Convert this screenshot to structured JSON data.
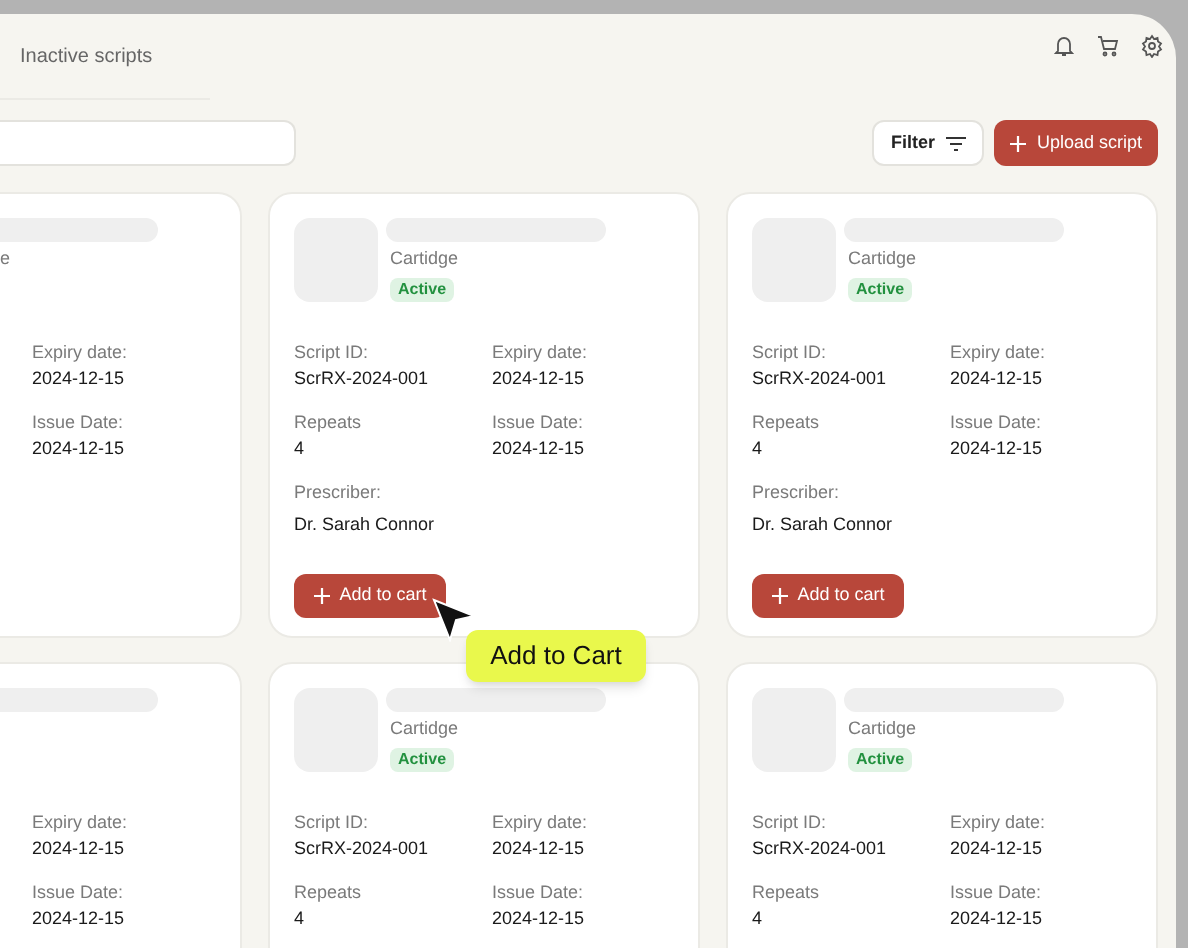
{
  "header": {
    "tab": "Inactive scripts"
  },
  "toolbar": {
    "filter": "Filter",
    "upload": "Upload script"
  },
  "cards": [
    {
      "kind": "clipped",
      "type": "e",
      "fields": [
        {
          "label": "Expiry date:",
          "value": "2024-12-15"
        },
        {
          "label": "Issue Date:",
          "value": "2024-12-15"
        }
      ]
    },
    {
      "kind": "full",
      "type": "Cartidge",
      "status": "Active",
      "fields": [
        {
          "label": "Script ID:",
          "value": "ScrRX-2024-001"
        },
        {
          "label": "Expiry date:",
          "value": "2024-12-15"
        },
        {
          "label": "Repeats",
          "value": "4"
        },
        {
          "label": "Issue Date:",
          "value": "2024-12-15"
        }
      ],
      "prescriber": {
        "label": "Prescriber:",
        "value": "Dr. Sarah Connor"
      },
      "button": "Add to cart"
    },
    {
      "kind": "full",
      "type": "Cartidge",
      "status": "Active",
      "fields": [
        {
          "label": "Script ID:",
          "value": "ScrRX-2024-001"
        },
        {
          "label": "Expiry date:",
          "value": "2024-12-15"
        },
        {
          "label": "Repeats",
          "value": "4"
        },
        {
          "label": "Issue Date:",
          "value": "2024-12-15"
        }
      ],
      "prescriber": {
        "label": "Prescriber:",
        "value": "Dr. Sarah Connor"
      },
      "button": "Add to cart"
    },
    {
      "kind": "clipped",
      "fields": [
        {
          "label": "Expiry date:",
          "value": "2024-12-15"
        },
        {
          "label": "Issue Date:",
          "value": "2024-12-15"
        }
      ]
    },
    {
      "kind": "full",
      "type": "Cartidge",
      "status": "Active",
      "fields": [
        {
          "label": "Script ID:",
          "value": "ScrRX-2024-001"
        },
        {
          "label": "Expiry date:",
          "value": "2024-12-15"
        },
        {
          "label": "Repeats",
          "value": "4"
        },
        {
          "label": "Issue Date:",
          "value": "2024-12-15"
        }
      ]
    },
    {
      "kind": "full",
      "type": "Cartidge",
      "status": "Active",
      "fields": [
        {
          "label": "Script ID:",
          "value": "ScrRX-2024-001"
        },
        {
          "label": "Expiry date:",
          "value": "2024-12-15"
        },
        {
          "label": "Repeats",
          "value": "4"
        },
        {
          "label": "Issue Date:",
          "value": "2024-12-15"
        }
      ]
    }
  ],
  "tooltip": {
    "text": "Add to Cart"
  }
}
